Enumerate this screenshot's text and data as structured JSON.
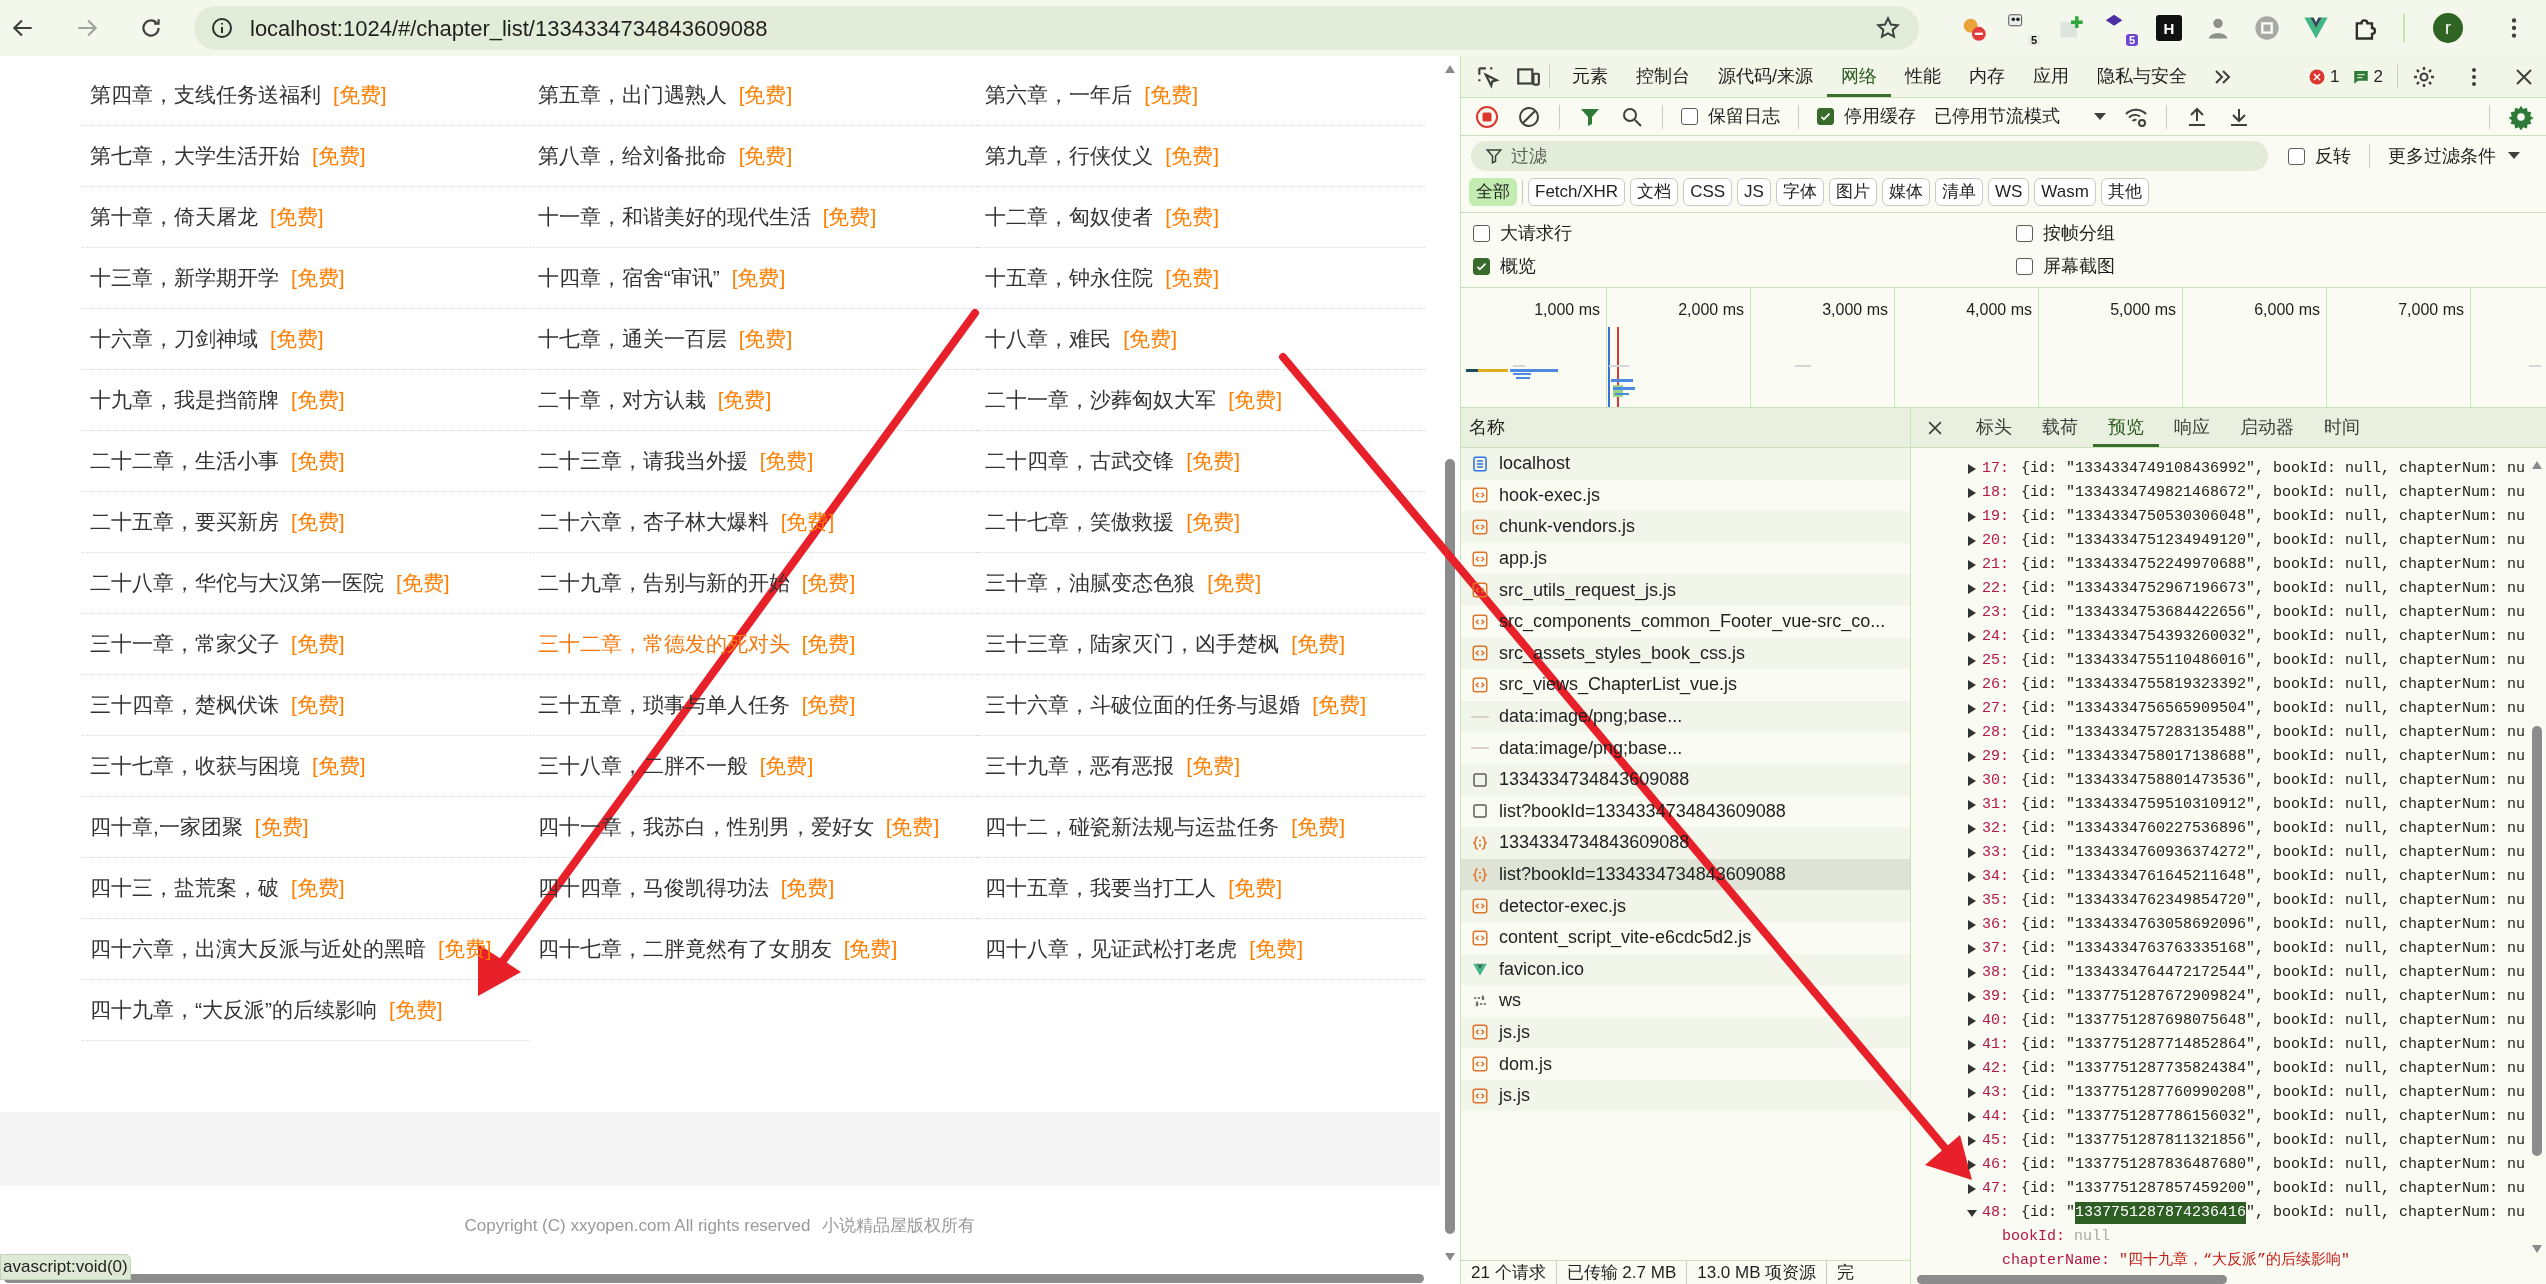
{
  "browser": {
    "address": "localhost:1024/#/chapter_list/1334334734843609088",
    "extensions": [
      {
        "kind": "blocker"
      },
      {
        "kind": "panda",
        "badge": "5"
      },
      {
        "kind": "plus"
      },
      {
        "kind": "stack",
        "badge": "5"
      },
      {
        "kind": "letter",
        "label": "H"
      },
      {
        "kind": "spy"
      },
      {
        "kind": "command"
      },
      {
        "kind": "vue"
      },
      {
        "kind": "puzzle"
      }
    ],
    "profile_initial": "r"
  },
  "page": {
    "chapters": [
      {
        "title": "第四章，支线任务送福利",
        "tag": "[免费]",
        "highlighted": false
      },
      {
        "title": "第五章，出门遇熟人",
        "tag": "[免费]",
        "highlighted": false
      },
      {
        "title": "第六章，一年后",
        "tag": "[免费]",
        "highlighted": false
      },
      {
        "title": "第七章，大学生活开始",
        "tag": "[免费]",
        "highlighted": false
      },
      {
        "title": "第八章，给刘备批命",
        "tag": "[免费]",
        "highlighted": false
      },
      {
        "title": "第九章，行侠仗义",
        "tag": "[免费]",
        "highlighted": false
      },
      {
        "title": "第十章，倚天屠龙",
        "tag": "[免费]",
        "highlighted": false
      },
      {
        "title": "十一章，和谐美好的现代生活",
        "tag": "[免费]",
        "highlighted": false
      },
      {
        "title": "十二章，匈奴使者",
        "tag": "[免费]",
        "highlighted": false
      },
      {
        "title": "十三章，新学期开学",
        "tag": "[免费]",
        "highlighted": false
      },
      {
        "title": "十四章，宿舍“审讯”",
        "tag": "[免费]",
        "highlighted": false
      },
      {
        "title": "十五章，钟永住院",
        "tag": "[免费]",
        "highlighted": false
      },
      {
        "title": "十六章，刀剑神域",
        "tag": "[免费]",
        "highlighted": false
      },
      {
        "title": "十七章，通关一百层",
        "tag": "[免费]",
        "highlighted": false
      },
      {
        "title": "十八章，难民",
        "tag": "[免费]",
        "highlighted": false
      },
      {
        "title": "十九章，我是挡箭牌",
        "tag": "[免费]",
        "highlighted": false
      },
      {
        "title": "二十章，对方认栽",
        "tag": "[免费]",
        "highlighted": false
      },
      {
        "title": "二十一章，沙葬匈奴大军",
        "tag": "[免费]",
        "highlighted": false
      },
      {
        "title": "二十二章，生活小事",
        "tag": "[免费]",
        "highlighted": false
      },
      {
        "title": "二十三章，请我当外援",
        "tag": "[免费]",
        "highlighted": false
      },
      {
        "title": "二十四章，古武交锋",
        "tag": "[免费]",
        "highlighted": false
      },
      {
        "title": "二十五章，要买新房",
        "tag": "[免费]",
        "highlighted": false
      },
      {
        "title": "二十六章，杏子林大爆料",
        "tag": "[免费]",
        "highlighted": false
      },
      {
        "title": "二十七章，笑傲救援",
        "tag": "[免费]",
        "highlighted": false
      },
      {
        "title": "二十八章，华佗与大汉第一医院",
        "tag": "[免费]",
        "highlighted": false
      },
      {
        "title": "二十九章，告别与新的开始",
        "tag": "[免费]",
        "highlighted": false
      },
      {
        "title": "三十章，油腻变态色狼",
        "tag": "[免费]",
        "highlighted": false
      },
      {
        "title": "三十一章，常家父子",
        "tag": "[免费]",
        "highlighted": false
      },
      {
        "title": "三十二章，常德发的死对头",
        "tag": "[免费]",
        "highlighted": true
      },
      {
        "title": "三十三章，陆家灭门，凶手楚枫",
        "tag": "[免费]",
        "highlighted": false
      },
      {
        "title": "三十四章，楚枫伏诛",
        "tag": "[免费]",
        "highlighted": false
      },
      {
        "title": "三十五章，琐事与单人任务",
        "tag": "[免费]",
        "highlighted": false
      },
      {
        "title": "三十六章，斗破位面的任务与退婚",
        "tag": "[免费]",
        "highlighted": false
      },
      {
        "title": "三十七章，收获与困境",
        "tag": "[免费]",
        "highlighted": false
      },
      {
        "title": "三十八章，二胖不一般",
        "tag": "[免费]",
        "highlighted": false
      },
      {
        "title": "三十九章，恶有恶报",
        "tag": "[免费]",
        "highlighted": false
      },
      {
        "title": "四十章,一家团聚",
        "tag": "[免费]",
        "highlighted": false
      },
      {
        "title": "四十一章，我苏白，性别男，爱好女",
        "tag": "[免费]",
        "highlighted": false
      },
      {
        "title": "四十二，碰瓷新法规与运盐任务",
        "tag": "[免费]",
        "highlighted": false
      },
      {
        "title": "四十三，盐荒案，破",
        "tag": "[免费]",
        "highlighted": false
      },
      {
        "title": "四十四章，马俊凯得功法",
        "tag": "[免费]",
        "highlighted": false
      },
      {
        "title": "四十五章，我要当打工人",
        "tag": "[免费]",
        "highlighted": false
      },
      {
        "title": "四十六章，出演大反派与近处的黑暗",
        "tag": "[免费]",
        "highlighted": false
      },
      {
        "title": "四十七章，二胖竟然有了女朋友",
        "tag": "[免费]",
        "highlighted": false
      },
      {
        "title": "四十八章，见证武松打老虎",
        "tag": "[免费]",
        "highlighted": false
      },
      {
        "title": "四十九章，“大反派”的后续影响",
        "tag": "[免费]",
        "highlighted": false
      }
    ],
    "footer": {
      "copyright": "Copyright (C) xxyopen.com All rights reserved",
      "rights": "小说精品屋版权所有"
    },
    "status_link": "avascript:void(0)"
  },
  "devtools": {
    "tabs": [
      {
        "label": "元素",
        "selected": false
      },
      {
        "label": "控制台",
        "selected": false
      },
      {
        "label": "源代码/来源",
        "selected": false
      },
      {
        "label": "网络",
        "selected": true
      },
      {
        "label": "性能",
        "selected": false
      },
      {
        "label": "内存",
        "selected": false
      },
      {
        "label": "应用",
        "selected": false
      },
      {
        "label": "隐私与安全",
        "selected": false
      }
    ],
    "error_count": "1",
    "message_count": "2",
    "toolbar": {
      "preserve_log": {
        "label": "保留日志",
        "checked": false
      },
      "disable_cache": {
        "label": "停用缓存",
        "checked": true
      },
      "throttling": "已停用节流模式"
    },
    "filter": {
      "placeholder": "过滤"
    },
    "invert": {
      "label": "反转",
      "checked": false
    },
    "more_filters": "更多过滤条件",
    "type_filters": [
      {
        "label": "全部",
        "selected": true
      },
      {
        "label": "Fetch/XHR",
        "selected": false
      },
      {
        "label": "文档",
        "selected": false
      },
      {
        "label": "CSS",
        "selected": false
      },
      {
        "label": "JS",
        "selected": false
      },
      {
        "label": "字体",
        "selected": false
      },
      {
        "label": "图片",
        "selected": false
      },
      {
        "label": "媒体",
        "selected": false
      },
      {
        "label": "清单",
        "selected": false
      },
      {
        "label": "WS",
        "selected": false
      },
      {
        "label": "Wasm",
        "selected": false
      },
      {
        "label": "其他",
        "selected": false
      }
    ],
    "options": [
      {
        "label": "大请求行",
        "checked": false
      },
      {
        "label": "按帧分组",
        "checked": false
      },
      {
        "label": "概览",
        "checked": true
      },
      {
        "label": "屏幕截图",
        "checked": false
      }
    ],
    "overview_ticks": [
      "1,000 ms",
      "2,000 ms",
      "3,000 ms",
      "4,000 ms",
      "5,000 ms",
      "6,000 ms",
      "7,000 ms"
    ],
    "requests": {
      "column": "名称",
      "rows": [
        {
          "name": "localhost",
          "kind": "document",
          "selected": false
        },
        {
          "name": "hook-exec.js",
          "kind": "script",
          "selected": false
        },
        {
          "name": "chunk-vendors.js",
          "kind": "script",
          "selected": false
        },
        {
          "name": "app.js",
          "kind": "script",
          "selected": false
        },
        {
          "name": "src_utils_request_js.js",
          "kind": "script",
          "selected": false
        },
        {
          "name": "src_components_common_Footer_vue-src_co...",
          "kind": "script",
          "selected": false
        },
        {
          "name": "src_assets_styles_book_css.js",
          "kind": "script",
          "selected": false
        },
        {
          "name": "src_views_ChapterList_vue.js",
          "kind": "script",
          "selected": false
        },
        {
          "name": "data:image/png;base...",
          "kind": "image",
          "selected": false
        },
        {
          "name": "data:image/png;base...",
          "kind": "image",
          "selected": false
        },
        {
          "name": "1334334734843609088",
          "kind": "fetch",
          "selected": false
        },
        {
          "name": "list?bookId=1334334734843609088",
          "kind": "fetch",
          "selected": false
        },
        {
          "name": "1334334734843609088",
          "kind": "json",
          "selected": false
        },
        {
          "name": "list?bookId=1334334734843609088",
          "kind": "json",
          "selected": true
        },
        {
          "name": "detector-exec.js",
          "kind": "script",
          "selected": false
        },
        {
          "name": "content_script_vite-e6cdc5d2.js",
          "kind": "script",
          "selected": false
        },
        {
          "name": "favicon.ico",
          "kind": "vue",
          "selected": false
        },
        {
          "name": "ws",
          "kind": "websocket",
          "selected": false
        },
        {
          "name": "js.js",
          "kind": "script",
          "selected": false
        },
        {
          "name": "dom.js",
          "kind": "script",
          "selected": false
        },
        {
          "name": "js.js",
          "kind": "script",
          "selected": false
        }
      ]
    },
    "status": [
      "21 个请求",
      "已传输 2.7 MB",
      "13.0 MB 项资源",
      "完"
    ],
    "detail_tabs": [
      {
        "label": "标头",
        "selected": false
      },
      {
        "label": "载荷",
        "selected": false
      },
      {
        "label": "预览",
        "selected": true
      },
      {
        "label": "响应",
        "selected": false
      },
      {
        "label": "启动器",
        "selected": false
      },
      {
        "label": "时间",
        "selected": false
      }
    ],
    "preview": [
      {
        "index": "17:",
        "open": "{id: \"",
        "id": "1334334749108436992",
        "rest": "\", bookId: null, chapterNum: nu",
        "expanded": false,
        "highlighted": false
      },
      {
        "index": "18:",
        "open": "{id: \"",
        "id": "1334334749821468672",
        "rest": "\", bookId: null, chapterNum: nu",
        "expanded": false,
        "highlighted": false
      },
      {
        "index": "19:",
        "open": "{id: \"",
        "id": "1334334750530306048",
        "rest": "\", bookId: null, chapterNum: nu",
        "expanded": false,
        "highlighted": false
      },
      {
        "index": "20:",
        "open": "{id: \"",
        "id": "1334334751234949120",
        "rest": "\", bookId: null, chapterNum: nu",
        "expanded": false,
        "highlighted": false
      },
      {
        "index": "21:",
        "open": "{id: \"",
        "id": "1334334752249970688",
        "rest": "\", bookId: null, chapterNum: nu",
        "expanded": false,
        "highlighted": false
      },
      {
        "index": "22:",
        "open": "{id: \"",
        "id": "1334334752967196673",
        "rest": "\", bookId: null, chapterNum: nu",
        "expanded": false,
        "highlighted": false
      },
      {
        "index": "23:",
        "open": "{id: \"",
        "id": "1334334753684422656",
        "rest": "\", bookId: null, chapterNum: nu",
        "expanded": false,
        "highlighted": false
      },
      {
        "index": "24:",
        "open": "{id: \"",
        "id": "1334334754393260032",
        "rest": "\", bookId: null, chapterNum: nu",
        "expanded": false,
        "highlighted": false
      },
      {
        "index": "25:",
        "open": "{id: \"",
        "id": "1334334755110486016",
        "rest": "\", bookId: null, chapterNum: nu",
        "expanded": false,
        "highlighted": false
      },
      {
        "index": "26:",
        "open": "{id: \"",
        "id": "1334334755819323392",
        "rest": "\", bookId: null, chapterNum: nu",
        "expanded": false,
        "highlighted": false
      },
      {
        "index": "27:",
        "open": "{id: \"",
        "id": "1334334756565909504",
        "rest": "\", bookId: null, chapterNum: nu",
        "expanded": false,
        "highlighted": false
      },
      {
        "index": "28:",
        "open": "{id: \"",
        "id": "1334334757283135488",
        "rest": "\", bookId: null, chapterNum: nu",
        "expanded": false,
        "highlighted": false
      },
      {
        "index": "29:",
        "open": "{id: \"",
        "id": "1334334758017138688",
        "rest": "\", bookId: null, chapterNum: nu",
        "expanded": false,
        "highlighted": false
      },
      {
        "index": "30:",
        "open": "{id: \"",
        "id": "1334334758801473536",
        "rest": "\", bookId: null, chapterNum: nu",
        "expanded": false,
        "highlighted": false
      },
      {
        "index": "31:",
        "open": "{id: \"",
        "id": "1334334759510310912",
        "rest": "\", bookId: null, chapterNum: nu",
        "expanded": false,
        "highlighted": false
      },
      {
        "index": "32:",
        "open": "{id: \"",
        "id": "1334334760227536896",
        "rest": "\", bookId: null, chapterNum: nu",
        "expanded": false,
        "highlighted": false
      },
      {
        "index": "33:",
        "open": "{id: \"",
        "id": "1334334760936374272",
        "rest": "\", bookId: null, chapterNum: nu",
        "expanded": false,
        "highlighted": false
      },
      {
        "index": "34:",
        "open": "{id: \"",
        "id": "1334334761645211648",
        "rest": "\", bookId: null, chapterNum: nu",
        "expanded": false,
        "highlighted": false
      },
      {
        "index": "35:",
        "open": "{id: \"",
        "id": "1334334762349854720",
        "rest": "\", bookId: null, chapterNum: nu",
        "expanded": false,
        "highlighted": false
      },
      {
        "index": "36:",
        "open": "{id: \"",
        "id": "1334334763058692096",
        "rest": "\", bookId: null, chapterNum: nu",
        "expanded": false,
        "highlighted": false
      },
      {
        "index": "37:",
        "open": "{id: \"",
        "id": "1334334763763335168",
        "rest": "\", bookId: null, chapterNum: nu",
        "expanded": false,
        "highlighted": false
      },
      {
        "index": "38:",
        "open": "{id: \"",
        "id": "1334334764472172544",
        "rest": "\", bookId: null, chapterNum: nu",
        "expanded": false,
        "highlighted": false
      },
      {
        "index": "39:",
        "open": "{id: \"",
        "id": "1337751287672909824",
        "rest": "\", bookId: null, chapterNum: nu",
        "expanded": false,
        "highlighted": false
      },
      {
        "index": "40:",
        "open": "{id: \"",
        "id": "1337751287698075648",
        "rest": "\", bookId: null, chapterNum: nu",
        "expanded": false,
        "highlighted": false
      },
      {
        "index": "41:",
        "open": "{id: \"",
        "id": "1337751287714852864",
        "rest": "\", bookId: null, chapterNum: nu",
        "expanded": false,
        "highlighted": false
      },
      {
        "index": "42:",
        "open": "{id: \"",
        "id": "1337751287735824384",
        "rest": "\", bookId: null, chapterNum: nu",
        "expanded": false,
        "highlighted": false
      },
      {
        "index": "43:",
        "open": "{id: \"",
        "id": "1337751287760990208",
        "rest": "\", bookId: null, chapterNum: nu",
        "expanded": false,
        "highlighted": false
      },
      {
        "index": "44:",
        "open": "{id: \"",
        "id": "1337751287786156032",
        "rest": "\", bookId: null, chapterNum: nu",
        "expanded": false,
        "highlighted": false
      },
      {
        "index": "45:",
        "open": "{id: \"",
        "id": "1337751287811321856",
        "rest": "\", bookId: null, chapterNum: nu",
        "expanded": false,
        "highlighted": false
      },
      {
        "index": "46:",
        "open": "{id: \"",
        "id": "1337751287836487680",
        "rest": "\", bookId: null, chapterNum: nu",
        "expanded": false,
        "highlighted": false
      },
      {
        "index": "47:",
        "open": "{id: \"",
        "id": "1337751287857459200",
        "rest": "\", bookId: null, chapterNum: nu",
        "expanded": false,
        "highlighted": false
      },
      {
        "index": "48:",
        "open": "{id: \"",
        "id": "1337751287874236416",
        "rest": "\", bookId: null, chapterNum: nu",
        "expanded": true,
        "highlighted": true,
        "children": [
          {
            "key": "bookId:",
            "value": "null",
            "kind": "null"
          },
          {
            "key": "chapterName:",
            "value": "\"四十九章，“大反派”的后续影响\"",
            "kind": "string"
          }
        ]
      }
    ]
  }
}
